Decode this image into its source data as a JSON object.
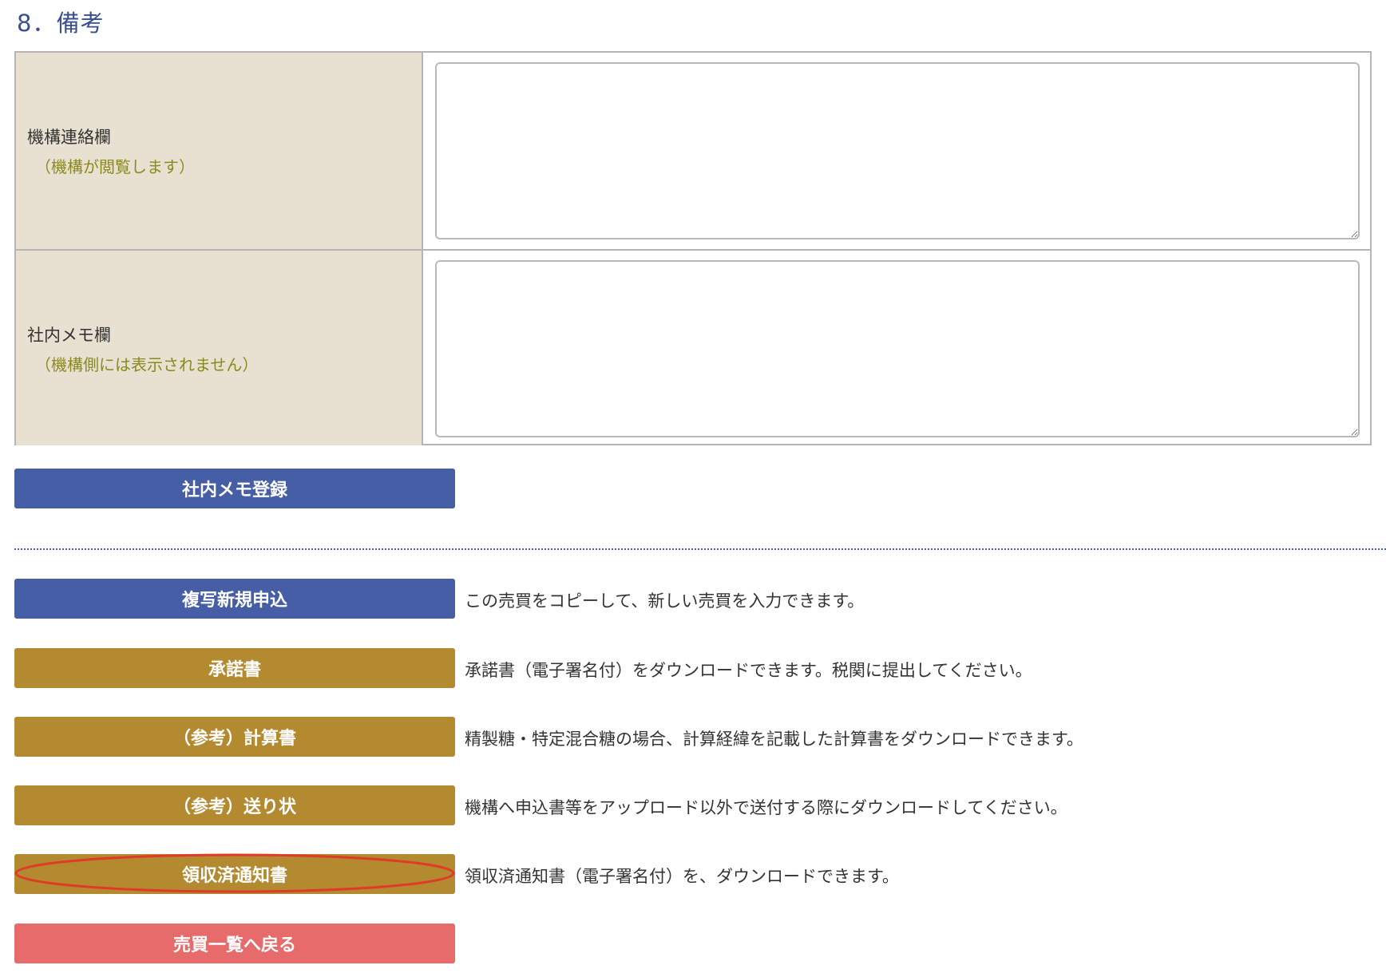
{
  "section": {
    "title": "8．備考"
  },
  "memo_rows": [
    {
      "label": "機構連絡欄",
      "sublabel": "（機構が閲覧します）",
      "value": ""
    },
    {
      "label": "社内メモ欄",
      "sublabel": "（機構側には表示されません）",
      "value": ""
    }
  ],
  "save_memo_button": "社内メモ登録",
  "actions": [
    {
      "label": "複写新規申込",
      "description": "この売買をコピーして、新しい売買を入力できます。",
      "color": "#455ea6"
    },
    {
      "label": "承諾書",
      "description": "承諾書（電子署名付）をダウンロードできます。税関に提出してください。",
      "color": "#b48a30"
    },
    {
      "label": "（参考）計算書",
      "description": "精製糖・特定混合糖の場合、計算経緯を記載した計算書をダウンロードできます。",
      "color": "#b48a30"
    },
    {
      "label": "（参考）送り状",
      "description": "機構へ申込書等をアップロード以外で送付する際にダウンロードしてください。",
      "color": "#b48a30"
    },
    {
      "label": "領収済通知書",
      "description": "領収済通知書（電子署名付）を、ダウンロードできます。",
      "color": "#b48a30"
    }
  ],
  "back_button": {
    "label": "売買一覧へ戻る",
    "color": "#e86b6b"
  },
  "highlight_color": "#e03a2a"
}
